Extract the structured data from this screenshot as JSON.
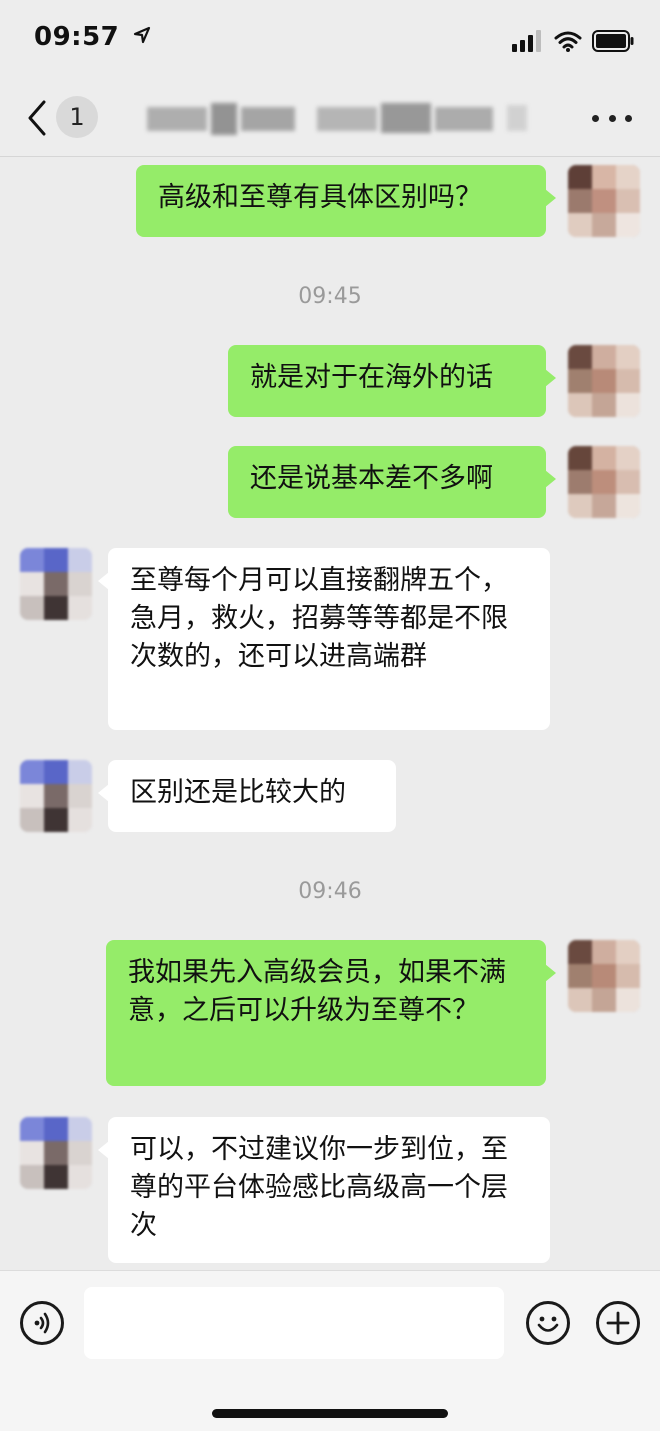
{
  "status_bar": {
    "time": "09:57",
    "location_icon": "location-arrow-icon",
    "signal_icon": "cellular-signal-icon",
    "wifi_icon": "wifi-icon",
    "battery_icon": "battery-icon"
  },
  "nav": {
    "back_icon": "chevron-left-icon",
    "unread_count": "1",
    "more_icon": "more-dots-icon"
  },
  "messages": [
    {
      "side": "out",
      "text": "高级和至尊有具体区别吗？"
    },
    {
      "timestamp": "09:45"
    },
    {
      "side": "out",
      "text": "就是对于在海外的话"
    },
    {
      "side": "out",
      "text": "还是说基本差不多啊"
    },
    {
      "side": "in",
      "text": "至尊每个月可以直接翻牌五个，急月，救火，招募等等都是不限次数的，还可以进高端群"
    },
    {
      "side": "in",
      "text": "区别还是比较大的"
    },
    {
      "timestamp": "09:46"
    },
    {
      "side": "out",
      "text": "我如果先入高级会员，如果不满意，之后可以升级为至尊不？"
    },
    {
      "side": "in",
      "text": "可以，不过建议你一步到位，至尊的平台体验感比高级高一个层次"
    }
  ],
  "input_bar": {
    "voice_icon": "voice-icon",
    "emoji_icon": "emoji-icon",
    "plus_icon": "plus-icon",
    "input_value": ""
  },
  "colors": {
    "outgoing_bubble": "#95ec69",
    "incoming_bubble": "#ffffff",
    "chat_background": "#ececec",
    "header_background": "#ededed"
  }
}
